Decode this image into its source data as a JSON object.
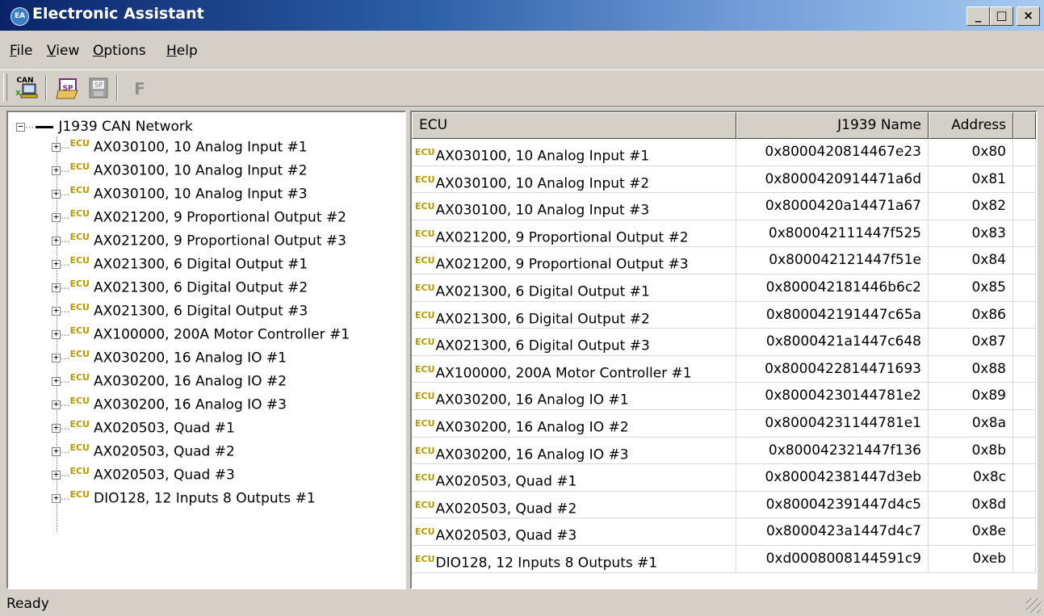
{
  "window": {
    "title": "Electronic Assistant",
    "icon": "ea-logo-icon",
    "icon_text": "EA",
    "minimize": "_",
    "maximize": "□",
    "close": "×"
  },
  "menu": [
    {
      "label": "File",
      "u": "F",
      "rest": "ile"
    },
    {
      "label": "View",
      "u": "V",
      "rest": "iew"
    },
    {
      "label": "Options",
      "u": "O",
      "rest": "ptions"
    },
    {
      "label": "Help",
      "u": "H",
      "rest": "elp"
    }
  ],
  "toolbar": {
    "can_label": "CAN",
    "f_label": "F",
    "buttons": [
      "can-network-icon",
      "setpoint-open-icon",
      "setpoint-save-icon",
      "flash-icon"
    ]
  },
  "tree": {
    "root_label": "J1939 CAN Network",
    "ecu_badge": "ECU",
    "items": [
      "AX030100, 10 Analog Input #1",
      "AX030100, 10 Analog Input #2",
      "AX030100, 10 Analog Input #3",
      "AX021200, 9 Proportional Output #2",
      "AX021200, 9 Proportional Output #3",
      "AX021300, 6 Digital Output #1",
      "AX021300, 6 Digital Output #2",
      "AX021300, 6 Digital Output #3",
      "AX100000, 200A Motor Controller #1",
      "AX030200, 16 Analog IO #1",
      "AX030200, 16 Analog IO #2",
      "AX030200, 16 Analog IO #3",
      "AX020503, Quad #1",
      "AX020503, Quad #2",
      "AX020503, Quad #3",
      "DIO128, 12 Inputs 8 Outputs #1"
    ]
  },
  "list": {
    "columns": [
      "ECU",
      "J1939 Name",
      "Address"
    ],
    "rows": [
      [
        "AX030100, 10 Analog Input #1",
        "0x8000420814467e23",
        "0x80"
      ],
      [
        "AX030100, 10 Analog Input #2",
        "0x8000420914471a6d",
        "0x81"
      ],
      [
        "AX030100, 10 Analog Input #3",
        "0x8000420a14471a67",
        "0x82"
      ],
      [
        "AX021200, 9 Proportional Output #2",
        "0x800042111447f525",
        "0x83"
      ],
      [
        "AX021200, 9 Proportional Output #3",
        "0x800042121447f51e",
        "0x84"
      ],
      [
        "AX021300, 6 Digital Output #1",
        "0x800042181446b6c2",
        "0x85"
      ],
      [
        "AX021300, 6 Digital Output #2",
        "0x800042191447c65a",
        "0x86"
      ],
      [
        "AX021300, 6 Digital Output #3",
        "0x8000421a1447c648",
        "0x87"
      ],
      [
        "AX100000, 200A Motor Controller #1",
        "0x8000422814471693",
        "0x88"
      ],
      [
        "AX030200, 16 Analog IO #1",
        "0x80004230144781e2",
        "0x89"
      ],
      [
        "AX030200, 16 Analog IO #2",
        "0x80004231144781e1",
        "0x8a"
      ],
      [
        "AX030200, 16 Analog IO #3",
        "0x800042321447f136",
        "0x8b"
      ],
      [
        "AX020503, Quad #1",
        "0x800042381447d3eb",
        "0x8c"
      ],
      [
        "AX020503, Quad #2",
        "0x800042391447d4c5",
        "0x8d"
      ],
      [
        "AX020503, Quad #3",
        "0x8000423a1447d4c7",
        "0x8e"
      ],
      [
        "DIO128, 12 Inputs 8 Outputs #1",
        "0xd0008008144591c9",
        "0xeb"
      ]
    ]
  },
  "status": {
    "text": "Ready"
  },
  "colors": {
    "title_start": "#0a246a",
    "title_end": "#a6caf0",
    "ecu_badge": "#b89a00",
    "chrome": "#d4d0c8"
  }
}
